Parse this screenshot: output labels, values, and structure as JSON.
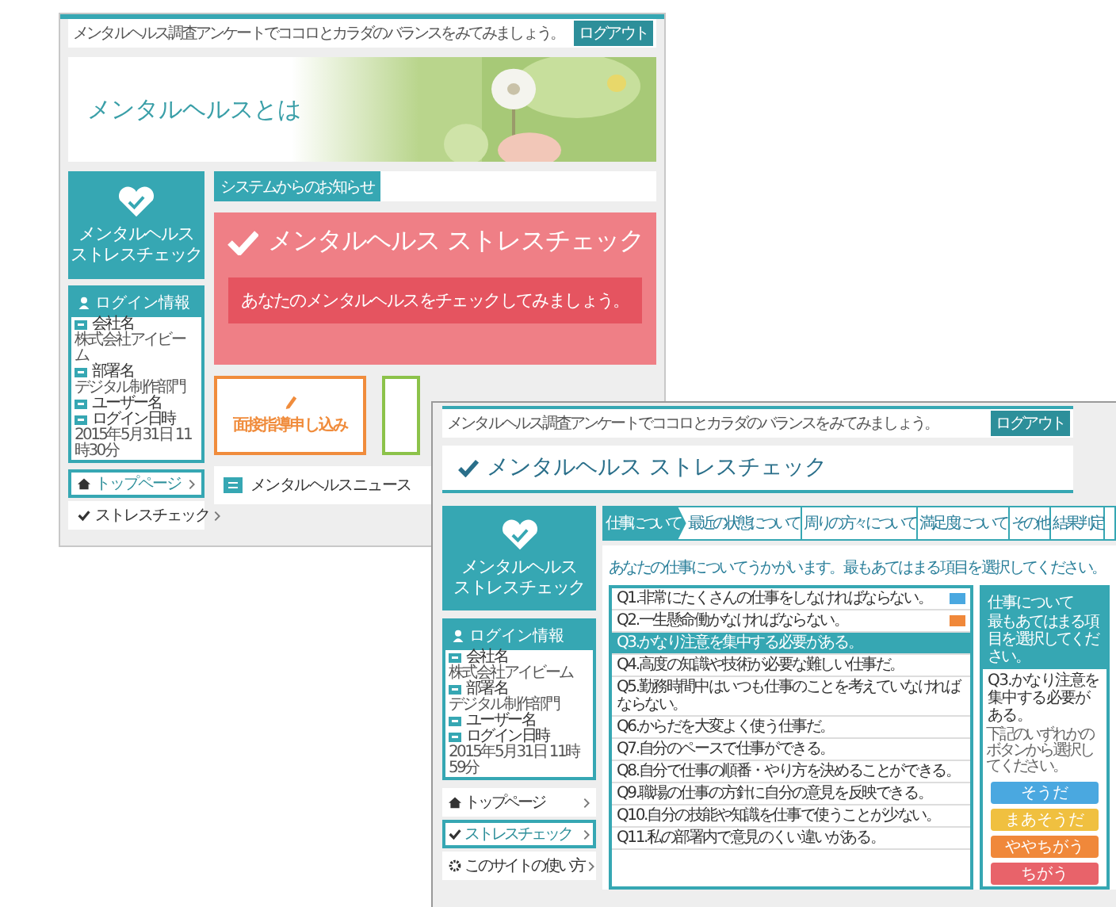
{
  "back_page": {
    "header": {
      "message": "メンタルヘルス調査アンケートでココロとカラダのバランスをみてみましょう。",
      "logout_button": "ログアウト"
    },
    "hero": {
      "title": "メンタルヘルスとは"
    },
    "logo": {
      "title_lines": [
        "メンタルヘルス",
        "ストレスチェック"
      ]
    },
    "login_info": {
      "title": "ログイン情報",
      "fields": [
        {
          "label": "会社名",
          "value": "株式会社アイビーム"
        },
        {
          "label": "部署名",
          "value": "デジタル制作部門"
        },
        {
          "label": "ユーザー名"
        },
        {
          "label": "ログイン日時",
          "value": "2015年5月31日 11時30分"
        }
      ]
    },
    "nav": [
      {
        "label": "トップページ",
        "selected": true
      },
      {
        "label": "ストレスチェック",
        "selected": false
      }
    ],
    "notice": {
      "label": "システムからのお知らせ"
    },
    "check_panel": {
      "title": "メンタルヘルス ストレスチェック",
      "button": "あなたのメンタルヘルスをチェックしてみましょう。"
    },
    "cards": [
      {
        "title": "面接指導申し込み",
        "color": "#f08c3c"
      },
      {
        "color": "#8cc24a"
      }
    ],
    "news": {
      "title": "メンタルヘルスニュース"
    }
  },
  "front_page": {
    "header": {
      "message": "メンタルヘルス調査アンケートでココロとカラダのバランスをみてみましょう。",
      "logout_button": "ログアウト"
    },
    "title": "メンタルヘルス ストレスチェック",
    "logo": {
      "title_lines": [
        "メンタルヘルス",
        "ストレスチェック"
      ]
    },
    "login_info": {
      "title": "ログイン情報",
      "fields": [
        {
          "label": "会社名",
          "value": "株式会社アイビーム"
        },
        {
          "label": "部署名",
          "value": "デジタル制作部門"
        },
        {
          "label": "ユーザー名"
        },
        {
          "label": "ログイン日時",
          "value": "2015年5月31日 11時59分"
        }
      ]
    },
    "nav": [
      {
        "label": "トップページ",
        "selected": false
      },
      {
        "label": "ストレスチェック",
        "selected": true
      },
      {
        "label": "このサイトの使い方",
        "selected": false
      }
    ],
    "steps": [
      {
        "label": "仕事について",
        "selected": true
      },
      {
        "label": "最近の状態について",
        "selected": false
      },
      {
        "label": "周りの方々について",
        "selected": false
      },
      {
        "label": "満足度について",
        "selected": false
      },
      {
        "label": "その他",
        "selected": false
      },
      {
        "label": "結果判定",
        "selected": false
      }
    ],
    "instruction": "あなたの仕事についてうかがいます。最もあてはまる項目を選択してください。",
    "questions": [
      {
        "text": "Q1.非常にたくさんの仕事をしなければならない。",
        "selected": false,
        "color": "#4aa8e0"
      },
      {
        "text": "Q2.一生懸命働かなければならない。",
        "selected": false,
        "color": "#f0883a"
      },
      {
        "text": "Q3.かなり注意を集中する必要がある。",
        "selected": true
      },
      {
        "text": "Q4.高度の知識や技術が必要な難しい仕事だ。",
        "selected": false
      },
      {
        "text": "Q5.勤務時間中はいつも仕事のことを考えていなければならない。",
        "selected": false
      },
      {
        "text": "Q6.からだを大変よく使う仕事だ。",
        "selected": false
      },
      {
        "text": "Q7.自分のペースで仕事ができる。",
        "selected": false
      },
      {
        "text": "Q8.自分で仕事の順番・やり方を決めることができる。",
        "selected": false
      },
      {
        "text": "Q9.職場の仕事の方針に自分の意見を反映できる。",
        "selected": false
      },
      {
        "text": "Q10.自分の技能や知識を仕事で使うことが少ない。",
        "selected": false
      },
      {
        "text": "Q11.私の部署内で意見のくい違いがある。",
        "selected": false
      }
    ],
    "answer_panel": {
      "title": "仕事について",
      "subtitle": "最もあてはまる項目を選択してください。",
      "question": "Q3.かなり注意を集中する必要がある。",
      "hint": "下記のいずれかのボタンから選択してください。",
      "options": [
        {
          "label": "そうだ",
          "color": "#4aa8e0"
        },
        {
          "label": "まあそうだ",
          "color": "#f0c040"
        },
        {
          "label": "ややちがう",
          "color": "#f0883a"
        },
        {
          "label": "ちがう",
          "color": "#e8636a"
        }
      ]
    }
  }
}
